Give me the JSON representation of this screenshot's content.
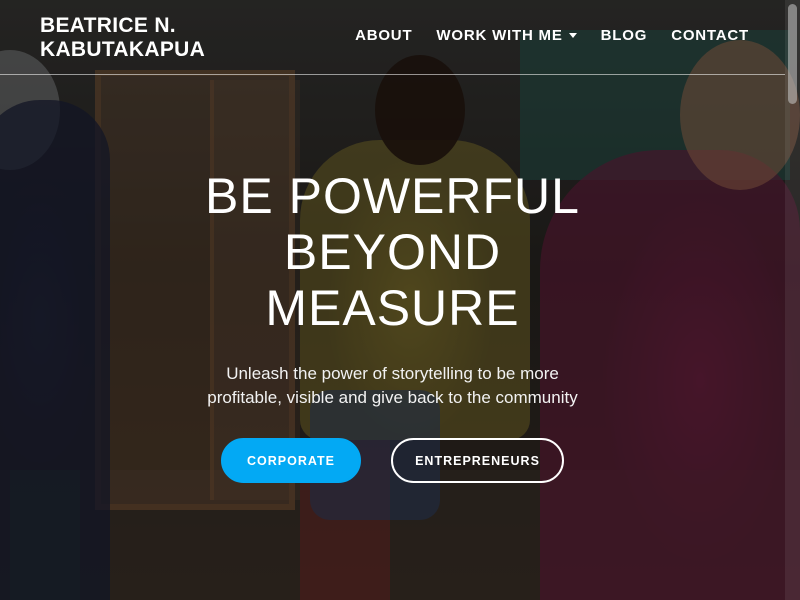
{
  "site": {
    "brand_line1": "BEATRICE N.",
    "brand_line2": "KABUTAKAPUA"
  },
  "nav": {
    "items": [
      {
        "label": "ABOUT"
      },
      {
        "label": "WORK WITH ME",
        "has_dropdown": true
      },
      {
        "label": "BLOG"
      },
      {
        "label": "CONTACT"
      }
    ]
  },
  "hero": {
    "headline_line1": "BE POWERFUL",
    "headline_line2": "BEYOND",
    "headline_line3": "MEASURE",
    "subtitle": "Unleash the power of storytelling to be more profitable, visible and give back to the community",
    "buttons": {
      "primary_label": "CORPORATE",
      "secondary_label": "ENTREPRENEURS"
    }
  },
  "colors": {
    "accent": "#03a9f4",
    "text": "#ffffff"
  },
  "icons": {
    "dropdown": "caret-down-icon"
  }
}
